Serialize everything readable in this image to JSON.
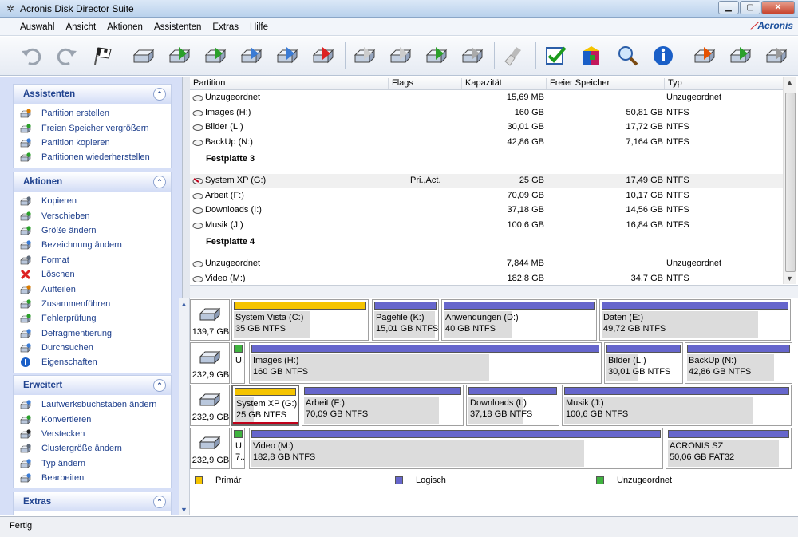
{
  "window": {
    "title": "Acronis Disk Director Suite"
  },
  "menu": [
    "Auswahl",
    "Ansicht",
    "Aktionen",
    "Assistenten",
    "Extras",
    "Hilfe"
  ],
  "brand": {
    "logo_text": "Acronis"
  },
  "toolbar": {
    "buttons": [
      {
        "icon": "undo-icon"
      },
      {
        "icon": "redo-icon"
      },
      {
        "icon": "commit-flag-icon"
      },
      {
        "icon": "disk-copy-icon"
      },
      {
        "icon": "disk-move-icon"
      },
      {
        "icon": "disk-resize-icon"
      },
      {
        "icon": "disk-label-icon"
      },
      {
        "icon": "disk-format-icon"
      },
      {
        "icon": "disk-delete-icon"
      },
      {
        "icon": "disk-split-icon"
      },
      {
        "icon": "disk-merge-icon"
      },
      {
        "icon": "disk-check-icon"
      },
      {
        "icon": "disk-defrag-icon"
      },
      {
        "icon": "cleanup-brush-icon"
      },
      {
        "icon": "checkmark-icon"
      },
      {
        "icon": "package-icon"
      },
      {
        "icon": "search-icon"
      },
      {
        "icon": "info-icon"
      },
      {
        "icon": "disk-tool-icon"
      },
      {
        "icon": "disk-transfer-icon"
      },
      {
        "icon": "disk-more-icon"
      }
    ]
  },
  "sidebar": {
    "panels": [
      {
        "title": "Assistenten",
        "items": [
          {
            "label": "Partition erstellen",
            "icon": "create-partition-icon"
          },
          {
            "label": "Freien Speicher vergrößern",
            "icon": "expand-space-icon"
          },
          {
            "label": "Partition kopieren",
            "icon": "copy-partition-icon"
          },
          {
            "label": "Partitionen wiederherstellen",
            "icon": "recover-partition-icon"
          }
        ]
      },
      {
        "title": "Aktionen",
        "items": [
          {
            "label": "Kopieren",
            "icon": "copy-icon"
          },
          {
            "label": "Verschieben",
            "icon": "move-icon"
          },
          {
            "label": "Größe ändern",
            "icon": "resize-icon"
          },
          {
            "label": "Bezeichnung ändern",
            "icon": "label-icon"
          },
          {
            "label": "Format",
            "icon": "format-icon"
          },
          {
            "label": "Löschen",
            "icon": "delete-icon"
          },
          {
            "label": "Aufteilen",
            "icon": "split-icon"
          },
          {
            "label": "Zusammenführen",
            "icon": "merge-icon"
          },
          {
            "label": "Fehlerprüfung",
            "icon": "check-errors-icon"
          },
          {
            "label": "Defragmentierung",
            "icon": "defrag-icon"
          },
          {
            "label": "Durchsuchen",
            "icon": "browse-icon"
          },
          {
            "label": "Eigenschaften",
            "icon": "properties-icon"
          }
        ]
      },
      {
        "title": "Erweitert",
        "items": [
          {
            "label": "Laufwerksbuchstaben ändern",
            "icon": "drive-letter-icon"
          },
          {
            "label": "Konvertieren",
            "icon": "convert-icon"
          },
          {
            "label": "Verstecken",
            "icon": "hide-icon"
          },
          {
            "label": "Clustergröße ändern",
            "icon": "cluster-size-icon"
          },
          {
            "label": "Typ ändern",
            "icon": "change-type-icon"
          },
          {
            "label": "Bearbeiten",
            "icon": "edit-icon"
          }
        ]
      },
      {
        "title": "Extras",
        "items": []
      }
    ]
  },
  "table": {
    "columns": [
      "Partition",
      "Flags",
      "Kapazität",
      "Freier Speicher",
      "Typ"
    ],
    "rows": [
      {
        "kind": "row",
        "partition": "Unzugeordnet",
        "flags": "",
        "capacity": "15,69 MB",
        "free": "",
        "type": "Unzugeordnet"
      },
      {
        "kind": "row",
        "partition": "Images (H:)",
        "flags": "",
        "capacity": "160 GB",
        "free": "50,81 GB",
        "type": "NTFS"
      },
      {
        "kind": "row",
        "partition": "Bilder (L:)",
        "flags": "",
        "capacity": "30,01 GB",
        "free": "17,72 GB",
        "type": "NTFS"
      },
      {
        "kind": "row",
        "partition": "BackUp (N:)",
        "flags": "",
        "capacity": "42,86 GB",
        "free": "7,164 GB",
        "type": "NTFS"
      },
      {
        "kind": "group",
        "label": "Festplatte 3"
      },
      {
        "kind": "row",
        "partition": "System XP (G:)",
        "flags": "Pri.,Act.",
        "capacity": "25 GB",
        "free": "17,49 GB",
        "type": "NTFS",
        "selected": true
      },
      {
        "kind": "row",
        "partition": "Arbeit (F:)",
        "flags": "",
        "capacity": "70,09 GB",
        "free": "10,17 GB",
        "type": "NTFS"
      },
      {
        "kind": "row",
        "partition": "Downloads (I:)",
        "flags": "",
        "capacity": "37,18 GB",
        "free": "14,56 GB",
        "type": "NTFS"
      },
      {
        "kind": "row",
        "partition": "Musik (J:)",
        "flags": "",
        "capacity": "100,6 GB",
        "free": "16,84 GB",
        "type": "NTFS"
      },
      {
        "kind": "group",
        "label": "Festplatte 4"
      },
      {
        "kind": "row",
        "partition": "Unzugeordnet",
        "flags": "",
        "capacity": "7,844 MB",
        "free": "",
        "type": "Unzugeordnet"
      },
      {
        "kind": "row",
        "partition": "Video (M:)",
        "flags": "",
        "capacity": "182,8 GB",
        "free": "34,7 GB",
        "type": "NTFS"
      }
    ]
  },
  "disk_map": {
    "disks": [
      {
        "size": "139,7 GB",
        "partitions": [
          {
            "name": "System Vista (C:)",
            "size": "35 GB  NTFS",
            "kind": "primary",
            "used_fraction": 0.57
          },
          {
            "name": "Pagefile (K:)",
            "size": "15,01 GB  NTFS",
            "kind": "logical",
            "used_fraction": 0.95
          },
          {
            "name": "Anwendungen (D:)",
            "size": "40 GB  NTFS",
            "kind": "logical",
            "used_fraction": 0.45
          },
          {
            "name": "Daten (E:)",
            "size": "49,72 GB  NTFS",
            "kind": "logical",
            "used_fraction": 0.83
          }
        ]
      },
      {
        "size": "232,9 GB",
        "partitions": [
          {
            "name": "U.",
            "size": "",
            "kind": "unallocated",
            "used_fraction": 0
          },
          {
            "name": "Images (H:)",
            "size": "160 GB  NTFS",
            "kind": "logical",
            "used_fraction": 0.68
          },
          {
            "name": "Bilder (L:)",
            "size": "30,01 GB  NTFS",
            "kind": "logical",
            "used_fraction": 0.41
          },
          {
            "name": "BackUp (N:)",
            "size": "42,86 GB  NTFS",
            "kind": "logical",
            "used_fraction": 0.83
          }
        ]
      },
      {
        "size": "232,9 GB",
        "partitions": [
          {
            "name": "System XP (G:)",
            "size": "25 GB  NTFS",
            "kind": "primary",
            "used_fraction": 0.3,
            "selected": true
          },
          {
            "name": "Arbeit (F:)",
            "size": "70,09 GB  NTFS",
            "kind": "logical",
            "used_fraction": 0.85
          },
          {
            "name": "Downloads (I:)",
            "size": "37,18 GB  NTFS",
            "kind": "logical",
            "used_fraction": 0.61
          },
          {
            "name": "Musik (J:)",
            "size": "100,6 GB  NTFS",
            "kind": "logical",
            "used_fraction": 0.83
          }
        ]
      },
      {
        "size": "232,9 GB",
        "partitions": [
          {
            "name": "U.",
            "size": "7..",
            "kind": "unallocated",
            "used_fraction": 0
          },
          {
            "name": "Video (M:)",
            "size": "182,8 GB  NTFS",
            "kind": "logical",
            "used_fraction": 0.81
          },
          {
            "name": "ACRONIS SZ",
            "size": "50,06 GB  FAT32",
            "kind": "logical",
            "used_fraction": 0.9
          }
        ]
      }
    ]
  },
  "legend": [
    {
      "label": "Primär",
      "color": "#f5c400"
    },
    {
      "label": "Logisch",
      "color": "#6666cc"
    },
    {
      "label": "Unzugeordnet",
      "color": "#3fb33f"
    }
  ],
  "colors": {
    "primary": "#f5c400",
    "logical": "#6666cc",
    "unallocated": "#3fb33f"
  },
  "status": {
    "text": "Fertig"
  }
}
